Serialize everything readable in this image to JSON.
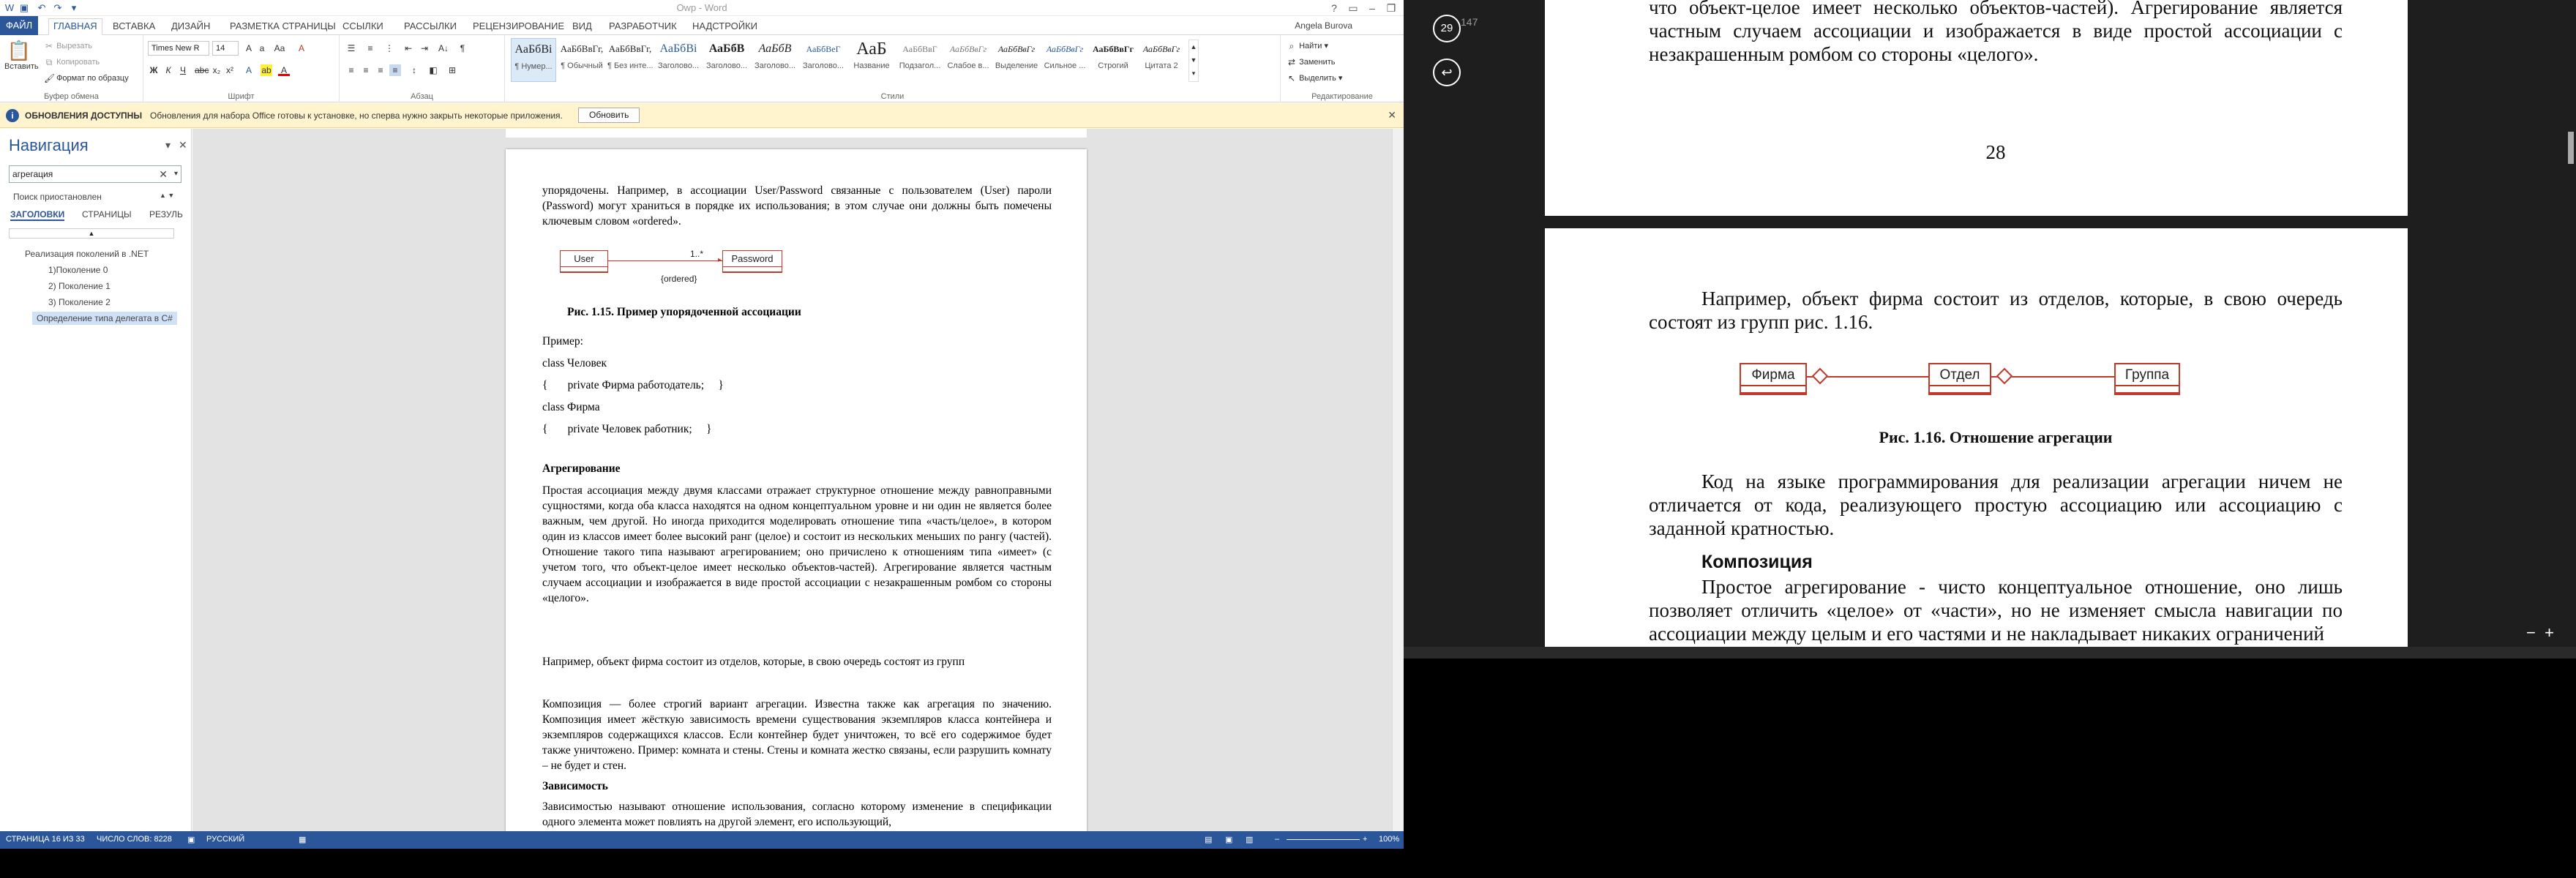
{
  "word": {
    "title": "Owp - Word",
    "user": "Angela Burova",
    "tabs": [
      "ФАЙЛ",
      "ГЛАВНАЯ",
      "ВСТАВКА",
      "ДИЗАЙН",
      "РАЗМЕТКА СТРАНИЦЫ",
      "ССЫЛКИ",
      "РАССЫЛКИ",
      "РЕЦЕНЗИРОВАНИЕ",
      "ВИД",
      "РАЗРАБОТЧИК",
      "НАДСТРОЙКИ"
    ],
    "ribbon": {
      "clipboard": {
        "label": "Буфер обмена",
        "paste": "Вставить",
        "cut": "Вырезать",
        "copy": "Копировать",
        "painter": "Формат по образцу"
      },
      "font": {
        "label": "Шрифт",
        "name": "Times New R",
        "size": "14"
      },
      "paragraph": {
        "label": "Абзац"
      },
      "styles": {
        "label": "Стили",
        "items": [
          {
            "prev": "АаБбВі",
            "name": "¶ Нумер..."
          },
          {
            "prev": "АаБбВвГг,",
            "name": "¶ Обычный"
          },
          {
            "prev": "АаБбВвГг,",
            "name": "¶ Без инте..."
          },
          {
            "prev": "АаБбВі",
            "name": "Заголово..."
          },
          {
            "prev": "АаБбВ",
            "name": "Заголово..."
          },
          {
            "prev": "АаБбВ",
            "name": "Заголово..."
          },
          {
            "prev": "АаБбВеГ",
            "name": "Заголово..."
          },
          {
            "prev": "АаБ",
            "name": "Название"
          },
          {
            "prev": "АаБбВвГ",
            "name": "Подзагол..."
          },
          {
            "prev": "АаБбВвГг",
            "name": "Слабое в..."
          },
          {
            "prev": "АаБбВвГг",
            "name": "Выделение"
          },
          {
            "prev": "АаБбВвГг",
            "name": "Сильное ..."
          },
          {
            "prev": "АаБбВвГг",
            "name": "Строгий"
          },
          {
            "prev": "АаБбВвГг",
            "name": "Цитата 2"
          }
        ]
      },
      "editing": {
        "label": "Редактирование",
        "find": "Найти",
        "replace": "Заменить",
        "select": "Выделить"
      }
    },
    "message": {
      "title": "ОБНОВЛЕНИЯ ДОСТУПНЫ",
      "text": "Обновления для набора Office готовы к установке, но сперва нужно закрыть некоторые приложения.",
      "button": "Обновить"
    },
    "nav": {
      "title": "Навигация",
      "search": "агрегация",
      "paused": "Поиск приостановлен",
      "tabs": [
        "ЗАГОЛОВКИ",
        "СТРАНИЦЫ",
        "РЕЗУЛЬ"
      ],
      "items": [
        "Реализация поколений в .NET",
        "1)Поколение 0",
        "2) Поколение 1",
        "3) Поколение 2",
        "Определение типа делегата в C#"
      ]
    },
    "doc": {
      "p1": "упорядочены. Например, в ассоциации User/Password связанные с пользователем (User) пароли (Password) могут храниться в порядке их использования; в этом случае они должны быть помечены ключевым словом «ordered».",
      "uml_user": "User",
      "uml_password": "Password",
      "uml_mult": "1..*",
      "uml_ordered": "{ordered}",
      "fig115": "Рис. 1.15. Пример упорядоченной ассоциации",
      "example": "Пример:",
      "code1": "class Человек",
      "code2": "{       private Фирма работодатель;     }",
      "code3": " class Фирма",
      "code4": "{       private Человек работник;     }",
      "h_aggr": "Агрегирование",
      "p_aggr": " Простая ассоциация между двумя классами отражает структурное отношение между равноправными сущностями, когда оба класса находятся на одном концептуальном уровне и ни один не является более важным, чем другой. Но иногда приходится моделировать отношение типа «часть/целое», в котором один из классов имеет более высокий ранг (целое) и состоит из нескольких меньших по рангу (частей). Отношение такого типа называют агрегированием; оно причислено к отношениям типа «имеет» (с учетом того, что объект-целое имеет несколько объектов-частей). Агрегирование является частным случаем ассоциации и изображается в виде простой ассоциации с незакрашенным ромбом со стороны «целого».",
      "p_ex": "Например,  объект фирма состоит из отделов, которые, в свою очередь состоят из групп",
      "p_comp": "Композиция — более строгий вариант агрегации. Известна также как агрегация по значению. Композиция имеет жёсткую зависимость времени существования экземпляров класса контейнера и экземпляров содержащихся классов. Если контейнер будет уничтожен, то всё его содержимое будет также уничтожено. Пример: комната и стены. Стены и комната жестко связаны, если разрушить комнату – не будет и стен.",
      "h_dep": "Зависимость",
      "p_dep": "Зависимостью называют отношение использования, согласно которому изменение в спецификации одного элемента может повлиять на другой элемент, его использующий,"
    },
    "status": {
      "page": "СТРАНИЦА 16 ИЗ 33",
      "words": "ЧИСЛО СЛОВ: 8228",
      "lang": "РУССКИЙ",
      "zoom": "100%"
    }
  },
  "viewer": {
    "page_counter": "29",
    "page_total": "147",
    "p_top": "что объект-целое имеет несколько объектов-частей). Агрегирование является частным случаем ассоциации и изображается в виде простой ассоциации с незакрашенным ромбом со стороны «целого».",
    "page_number": "28",
    "p_ex": "Например,  объект фирма состоит из отделов, которые, в свою очередь состоят из групп рис. 1.16.",
    "uml": [
      "Фирма",
      "Отдел",
      "Группа"
    ],
    "fig116": "Рис. 1.16. Отношение агрегации",
    "p_code": "Код на языке программирования для реализации агрегации ничем не отличается от кода, реализующего простую ассоциацию или ассоциацию с заданной кратностью.",
    "h_comp": "Композиция",
    "p_simple": "Простое агрегирование - чисто концептуальное отношение, оно лишь позволяет отличить «целое» от «части», но не изменяет смысла навигации по ассоциации между целым и его частями и не накладывает никаких ограничений"
  }
}
